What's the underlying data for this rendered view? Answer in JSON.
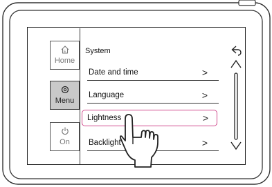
{
  "sidebar": {
    "items": [
      {
        "label": "Home",
        "icon": "home-icon"
      },
      {
        "label": "Menu",
        "icon": "gear-icon"
      },
      {
        "label": "On",
        "icon": "power-icon"
      }
    ],
    "active": "Menu"
  },
  "main": {
    "title": "System",
    "items": [
      {
        "label": "Date and time",
        "chevron": ">"
      },
      {
        "label": "Language",
        "chevron": ">"
      },
      {
        "label": "Lightness",
        "chevron": ">"
      },
      {
        "label": "Backlight",
        "chevron": ">"
      }
    ],
    "selected": "Lightness"
  },
  "controls": {
    "back_icon": "back-arrow-icon",
    "scroll_up_icon": "chevron-up-icon",
    "scroll_down_icon": "chevron-down-icon"
  },
  "colors": {
    "highlight": "#d0488b",
    "active_nav": "#c9c9c9"
  }
}
